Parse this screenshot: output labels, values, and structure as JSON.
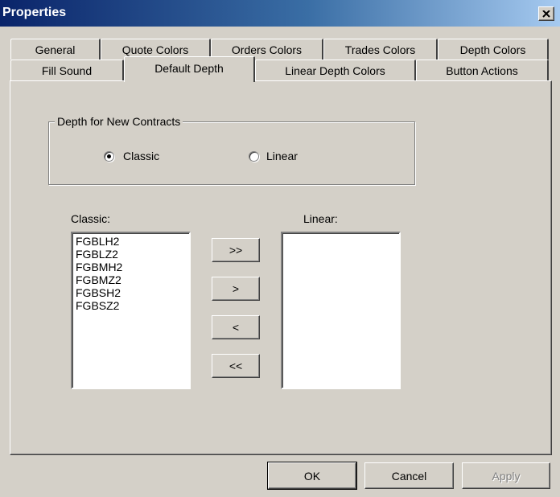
{
  "window": {
    "title": "Properties"
  },
  "tabs_row1": [
    "General",
    "Quote Colors",
    "Orders Colors",
    "Trades Colors",
    "Depth Colors"
  ],
  "tabs_row2": [
    "Fill Sound",
    "Default Depth",
    "Linear Depth Colors",
    "Button Actions"
  ],
  "active_tab": "Default Depth",
  "group": {
    "label": "Depth for New Contracts",
    "options": [
      "Classic",
      "Linear"
    ],
    "selected": "Classic"
  },
  "classic_list": {
    "label": "Classic:",
    "items": [
      "FGBLH2",
      "FGBLZ2",
      "FGBMH2",
      "FGBMZ2",
      "FGBSH2",
      "FGBSZ2"
    ]
  },
  "linear_list": {
    "label": "Linear:",
    "items": []
  },
  "move_buttons": {
    "all_right": ">>",
    "right": ">",
    "left": "<",
    "all_left": "<<"
  },
  "footer": {
    "ok": "OK",
    "cancel": "Cancel",
    "apply": "Apply"
  }
}
